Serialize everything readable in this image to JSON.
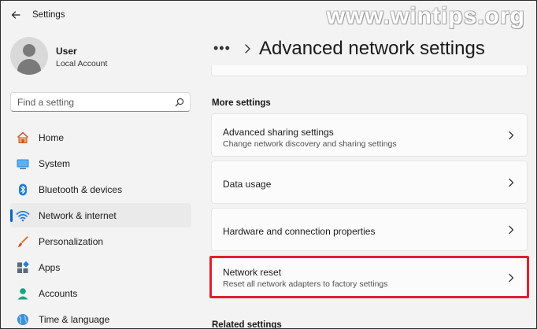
{
  "app": {
    "title": "Settings",
    "back_icon": "back-arrow-icon"
  },
  "watermark": "www.wintips.org",
  "profile": {
    "name": "User",
    "account_type": "Local Account"
  },
  "search": {
    "placeholder": "Find a setting",
    "value": ""
  },
  "nav": {
    "items": [
      {
        "label": "Home",
        "icon": "home-icon",
        "selected": false
      },
      {
        "label": "System",
        "icon": "system-icon",
        "selected": false
      },
      {
        "label": "Bluetooth & devices",
        "icon": "bluetooth-icon",
        "selected": false
      },
      {
        "label": "Network & internet",
        "icon": "wifi-icon",
        "selected": true
      },
      {
        "label": "Personalization",
        "icon": "brush-icon",
        "selected": false
      },
      {
        "label": "Apps",
        "icon": "apps-icon",
        "selected": false
      },
      {
        "label": "Accounts",
        "icon": "accounts-icon",
        "selected": false
      },
      {
        "label": "Time & language",
        "icon": "globe-icon",
        "selected": false
      }
    ]
  },
  "header": {
    "more_label": "•••",
    "page_title": "Advanced network settings"
  },
  "sections": {
    "more_settings": "More settings",
    "related_settings": "Related settings"
  },
  "cards": [
    {
      "title": "Advanced sharing settings",
      "subtitle": "Change network discovery and sharing settings"
    },
    {
      "title": "Data usage",
      "subtitle": ""
    },
    {
      "title": "Hardware and connection properties",
      "subtitle": ""
    },
    {
      "title": "Network reset",
      "subtitle": "Reset all network adapters to factory settings",
      "highlighted": true
    }
  ],
  "colors": {
    "accent": "#0067c0",
    "highlight": "#e0202f",
    "background": "#f3f3f3",
    "card": "#fbfbfb"
  }
}
